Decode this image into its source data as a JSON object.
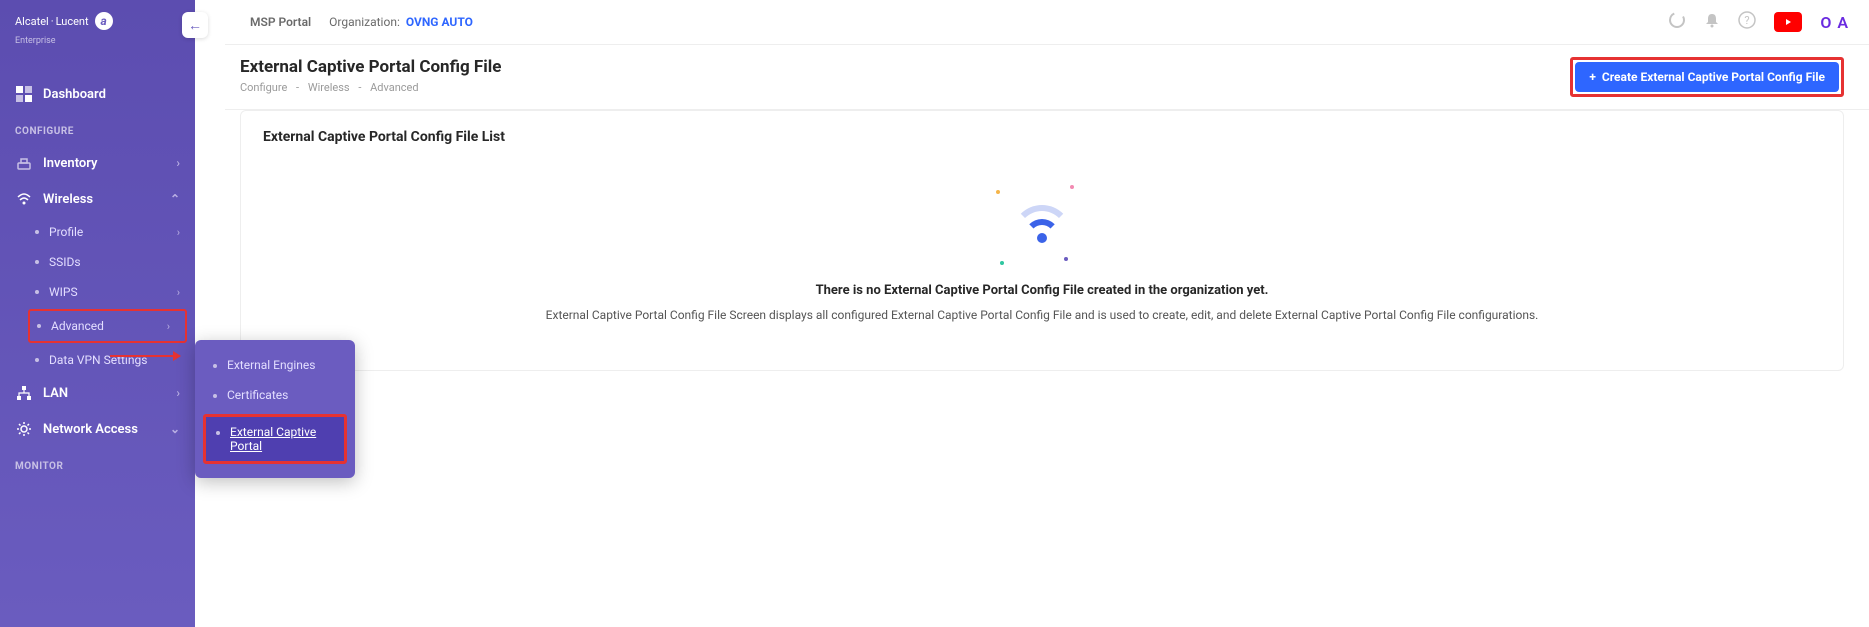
{
  "brand": {
    "name1": "Alcatel",
    "name2": "Lucent",
    "sub": "Enterprise"
  },
  "topbar": {
    "portal": "MSP Portal",
    "org_label": "Organization:",
    "org_name": "OVNG AUTO",
    "avatar": "O A"
  },
  "sidebar": {
    "dashboard": "Dashboard",
    "section_configure": "CONFIGURE",
    "inventory": "Inventory",
    "wireless": {
      "label": "Wireless",
      "items": [
        "Profile",
        "SSIDs",
        "WIPS",
        "Advanced",
        "Data VPN Settings"
      ]
    },
    "lan": "LAN",
    "network_access": "Network Access",
    "section_monitor": "MONITOR"
  },
  "flyout": {
    "items": [
      "External Engines",
      "Certificates",
      "External Captive Portal"
    ]
  },
  "page": {
    "title": "External Captive Portal Config File",
    "breadcrumb": [
      "Configure",
      "Wireless",
      "Advanced"
    ],
    "create_btn": "Create External Captive Portal Config File",
    "card_title": "External Captive Portal Config File List",
    "empty_title": "There is no External Captive Portal Config File created in the organization yet.",
    "empty_desc": "External Captive Portal Config File Screen displays all configured External Captive Portal Config File and is used to create, edit, and delete External Captive Portal Config File configurations."
  }
}
